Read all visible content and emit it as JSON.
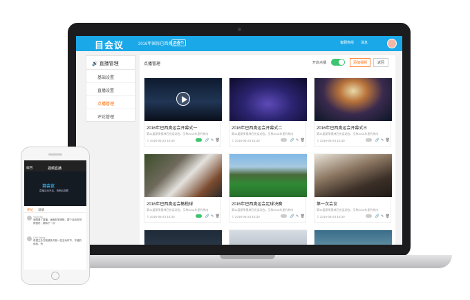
{
  "header": {
    "logo": "目会议",
    "event_title": "2016年国际巴西奥运会",
    "event_badge": "已发布",
    "phone_label": "客服热线",
    "message_label": "消息"
  },
  "sidebar": {
    "title": "直播管理",
    "items": [
      {
        "label": "基础设置"
      },
      {
        "label": "直播设置"
      },
      {
        "label": "点播管理"
      },
      {
        "label": "评论管理"
      }
    ]
  },
  "main": {
    "title": "点播管理",
    "toggle_label": "开启点播",
    "add_button": "添加视频",
    "back_button": "返回"
  },
  "cards": [
    {
      "title": "2016年巴西奥运会开幕式一",
      "desc": "第31届夏季奥林匹克运动会，又称2016年里约热内",
      "date": "2016-08-23 16:30",
      "on": true
    },
    {
      "title": "2016年巴西奥运会开幕式二",
      "desc": "第31届夏季奥林匹克运动会，又称2016年里约热内",
      "date": "2016-08-23 16:30",
      "on": false
    },
    {
      "title": "2016年巴西奥运会开幕式三",
      "desc": "第31届夏季奥林匹克运动会，又称2016年里约热内",
      "date": "2016-08-23 16:30",
      "on": false
    },
    {
      "title": "2016年巴西奥运会橄榄球",
      "desc": "第31届夏季奥林匹克运动会，又称2016年里约热内",
      "date": "2016-08-23 16:30",
      "on": true
    },
    {
      "title": "2016年巴西奥运会足球决赛",
      "desc": "第31届夏季奥林匹克运动会，又称2016年里约热内",
      "date": "2016-08-23 16:30",
      "on": false
    },
    {
      "title": "第一次会议",
      "desc": "第31届夏季奥林匹克运动会，又称2016年里约热内",
      "date": "2016-08-23 16:30",
      "on": false
    }
  ],
  "phone": {
    "back": "返回",
    "title": "视频直播",
    "video_logo": "目会议",
    "video_text": "直播活动开启，请稍后观看",
    "tabs": [
      "评论",
      "详情"
    ],
    "comments": [
      {
        "name": "Yoyo Hui",
        "text": "我刚看了直播，画面非常清晰，整个活动安排得很好，期待下一次"
      },
      {
        "name": "Ochi Wang",
        "text": "希望主办方能够多开放一些互动环节，不错的体验，赞"
      }
    ]
  }
}
